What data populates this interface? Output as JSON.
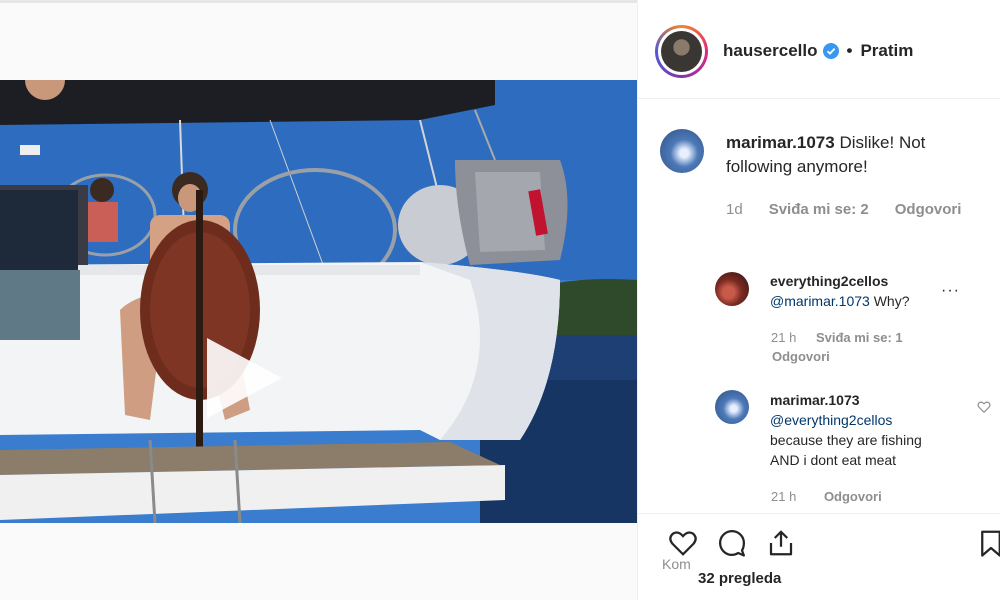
{
  "post": {
    "author": "hausercello",
    "follow_status": "Pratim",
    "separator": "•"
  },
  "main_comment": {
    "user": "marimar.1073",
    "text": "Dislike! Not following anymore!",
    "time": "1d",
    "likes": "Sviđa mi se: 2",
    "reply": "Odgovori"
  },
  "replies": [
    {
      "user": "everything2cellos",
      "mention": "@marimar.1073",
      "text": "Why?",
      "time": "21 h",
      "likes": "Sviđa mi se: 1",
      "reply": "Odgovori"
    },
    {
      "user": "marimar.1073",
      "mention": "@everything2cellos",
      "text_line1": "because they are fishing",
      "text_line2": "AND i dont eat meat",
      "time": "21 h",
      "reply": "Odgovori"
    }
  ],
  "actions": {
    "views": "32 pregleda",
    "comment_hint": "Kom"
  },
  "colors": {
    "verified": "#3897f0",
    "mention": "#00376b",
    "muted": "#8e8e8e",
    "sky": "#2f6fb4"
  }
}
